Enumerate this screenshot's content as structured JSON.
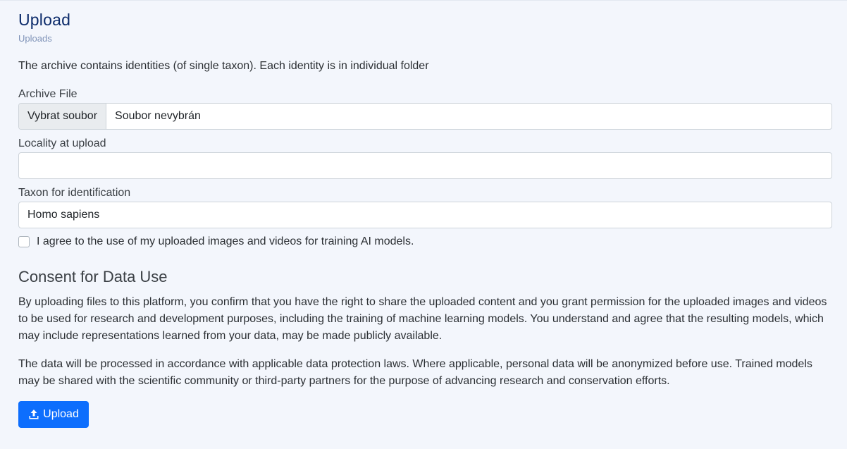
{
  "header": {
    "title": "Upload",
    "breadcrumb": "Uploads"
  },
  "description": "The archive contains identities (of single taxon). Each identity is in individual folder",
  "form": {
    "archive_label": "Archive File",
    "archive_button": "Vybrat soubor",
    "archive_value": "Soubor nevybrán",
    "locality_label": "Locality at upload",
    "locality_value": "",
    "taxon_label": "Taxon for identification",
    "taxon_value": "Homo sapiens",
    "consent_checkbox_label": "I agree to the use of my uploaded images and videos for training AI models.",
    "consent_checked": false
  },
  "consent": {
    "title": "Consent for Data Use",
    "paragraph1": "By uploading files to this platform, you confirm that you have the right to share the uploaded content and you grant permission for the uploaded images and videos to be used for research and development purposes, including the training of machine learning models. You understand and agree that the resulting models, which may include representations learned from your data, may be made publicly available.",
    "paragraph2": "The data will be processed in accordance with applicable data protection laws. Where applicable, personal data will be anonymized before use. Trained models may be shared with the scientific community or third-party partners for the purpose of advancing research and conservation efforts."
  },
  "actions": {
    "upload_label": "Upload",
    "upload_icon": "upload-icon"
  },
  "colors": {
    "background": "#f3f6fc",
    "title": "#0d2c6b",
    "primary": "#0d6efd"
  }
}
